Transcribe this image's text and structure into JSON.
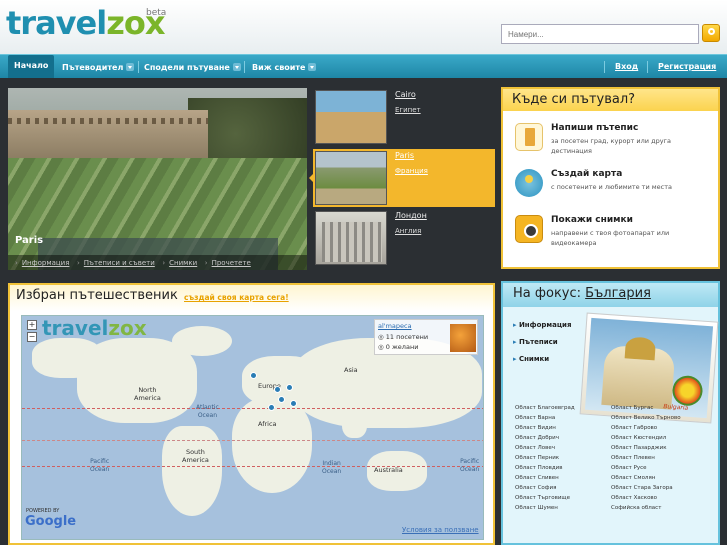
{
  "header": {
    "logo_part1": "travel",
    "logo_part2": "zox",
    "beta": "beta",
    "search_placeholder": "Намери..."
  },
  "nav": {
    "items": [
      {
        "label": "Начало"
      },
      {
        "label": "Пътеводител"
      },
      {
        "label": "Сподели пътуване"
      },
      {
        "label": "Виж своите"
      }
    ],
    "login": "Вход",
    "register": "Регистрация"
  },
  "hero": {
    "title": "Paris",
    "links": [
      "Информация",
      "Пътеписи и съвети",
      "Снимки",
      "Прочетете"
    ]
  },
  "destinations": [
    {
      "city": "Cairo",
      "country": "Египет"
    },
    {
      "city": "Paris",
      "country": "Франция"
    },
    {
      "city": "Лондон",
      "country": "Англия"
    }
  ],
  "where": {
    "title": "Къде си пътувал?",
    "items": [
      {
        "title": "Напиши пътепис",
        "desc": "за посетен град, курорт или друга дестинация",
        "icon": "notebook-icon"
      },
      {
        "title": "Създай карта",
        "desc": "с посетените и любимите ти места",
        "icon": "map-globe-icon"
      },
      {
        "title": "Покажи снимки",
        "desc": "направени с твоя фотоапарат или видеокамера",
        "icon": "camera-icon"
      }
    ]
  },
  "featured": {
    "title": "Избран пътешественик",
    "cta": "създай своя карта сега!",
    "map": {
      "logo_a": "travel",
      "logo_b": "zox",
      "zoom_in": "+",
      "zoom_out": "−",
      "powered_by": "POWERED BY",
      "google": "Google",
      "terms": "Условия за ползване",
      "popup_link": "al'mapeca",
      "popup_visited": "11 посетени",
      "popup_wanted": "0 желани",
      "labels": {
        "north_america": "North\nAmerica",
        "south_america": "South\nAmerica",
        "europe": "Europe",
        "asia": "Asia",
        "africa": "Africa",
        "australia": "Australia",
        "atlantic": "Atlantic\nOcean",
        "pacific_left": "Pacific\nOcean",
        "pacific_right": "Pacific\nOcean",
        "indian": "Indian\nOcean"
      }
    }
  },
  "focus": {
    "label": "На фокус:",
    "country": "България",
    "links": [
      "Информация",
      "Пътеписи",
      "Снимки"
    ],
    "image_label": "Bulgaria",
    "regions_left": [
      "Област Благоевград",
      "Област Варна",
      "Област Видин",
      "Област Добрич",
      "Област Ловеч",
      "Област Перник",
      "Област Пловдив",
      "Област Сливен",
      "Област София",
      "Област Търговище",
      "Област Шумен"
    ],
    "regions_right": [
      "Област Бургас",
      "Област Велико Търново",
      "Област Габрово",
      "Област Кюстендил",
      "Област Пазарджик",
      "Област Плевен",
      "Област Русе",
      "Област Смолян",
      "Област Стара Загора",
      "Област Хасково",
      "Софийска област"
    ]
  }
}
